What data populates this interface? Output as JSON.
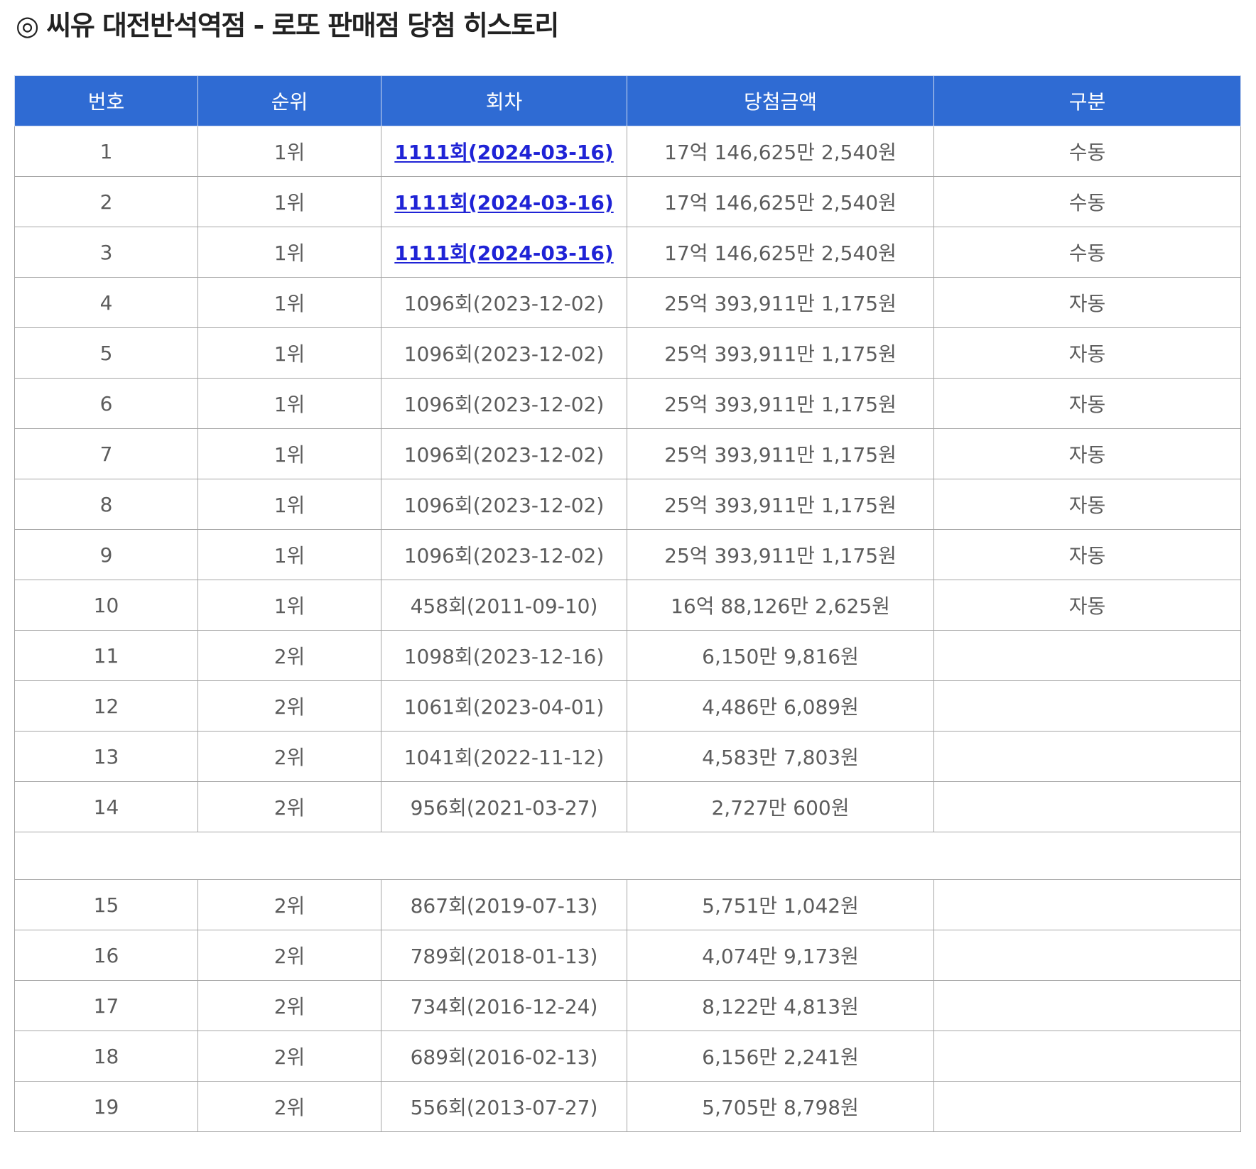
{
  "page": {
    "title": "◎ 씨유 대전반석역점 - 로또 판매점 당첨 히스토리"
  },
  "table": {
    "headers": [
      "번호",
      "순위",
      "회차",
      "당첨금액",
      "구분"
    ],
    "rows": [
      {
        "no": "1",
        "rank": "1위",
        "draw": "1111회(2024-03-16)",
        "amount": "17억 146,625만 2,540원",
        "type": "수동",
        "link": true
      },
      {
        "no": "2",
        "rank": "1위",
        "draw": "1111회(2024-03-16)",
        "amount": "17억 146,625만 2,540원",
        "type": "수동",
        "link": true
      },
      {
        "no": "3",
        "rank": "1위",
        "draw": "1111회(2024-03-16)",
        "amount": "17억 146,625만 2,540원",
        "type": "수동",
        "link": true
      },
      {
        "no": "4",
        "rank": "1위",
        "draw": "1096회(2023-12-02)",
        "amount": "25억 393,911만 1,175원",
        "type": "자동",
        "link": false
      },
      {
        "no": "5",
        "rank": "1위",
        "draw": "1096회(2023-12-02)",
        "amount": "25억 393,911만 1,175원",
        "type": "자동",
        "link": false
      },
      {
        "no": "6",
        "rank": "1위",
        "draw": "1096회(2023-12-02)",
        "amount": "25억 393,911만 1,175원",
        "type": "자동",
        "link": false
      },
      {
        "no": "7",
        "rank": "1위",
        "draw": "1096회(2023-12-02)",
        "amount": "25억 393,911만 1,175원",
        "type": "자동",
        "link": false
      },
      {
        "no": "8",
        "rank": "1위",
        "draw": "1096회(2023-12-02)",
        "amount": "25억 393,911만 1,175원",
        "type": "자동",
        "link": false
      },
      {
        "no": "9",
        "rank": "1위",
        "draw": "1096회(2023-12-02)",
        "amount": "25억 393,911만 1,175원",
        "type": "자동",
        "link": false
      },
      {
        "no": "10",
        "rank": "1위",
        "draw": "458회(2011-09-10)",
        "amount": "16억 88,126만 2,625원",
        "type": "자동",
        "link": false
      },
      {
        "no": "11",
        "rank": "2위",
        "draw": "1098회(2023-12-16)",
        "amount": "6,150만 9,816원",
        "type": "",
        "link": false
      },
      {
        "no": "12",
        "rank": "2위",
        "draw": "1061회(2023-04-01)",
        "amount": "4,486만 6,089원",
        "type": "",
        "link": false
      },
      {
        "no": "13",
        "rank": "2위",
        "draw": "1041회(2022-11-12)",
        "amount": "4,583만 7,803원",
        "type": "",
        "link": false
      },
      {
        "no": "14",
        "rank": "2위",
        "draw": "956회(2021-03-27)",
        "amount": "2,727만 600원",
        "type": "",
        "link": false
      },
      {
        "spacer": true
      },
      {
        "no": "15",
        "rank": "2위",
        "draw": "867회(2019-07-13)",
        "amount": "5,751만 1,042원",
        "type": "",
        "link": false
      },
      {
        "no": "16",
        "rank": "2위",
        "draw": "789회(2018-01-13)",
        "amount": "4,074만 9,173원",
        "type": "",
        "link": false
      },
      {
        "no": "17",
        "rank": "2위",
        "draw": "734회(2016-12-24)",
        "amount": "8,122만 4,813원",
        "type": "",
        "link": false
      },
      {
        "no": "18",
        "rank": "2위",
        "draw": "689회(2016-02-13)",
        "amount": "6,156만 2,241원",
        "type": "",
        "link": false
      },
      {
        "no": "19",
        "rank": "2위",
        "draw": "556회(2013-07-27)",
        "amount": "5,705만 8,798원",
        "type": "",
        "link": false
      }
    ]
  }
}
